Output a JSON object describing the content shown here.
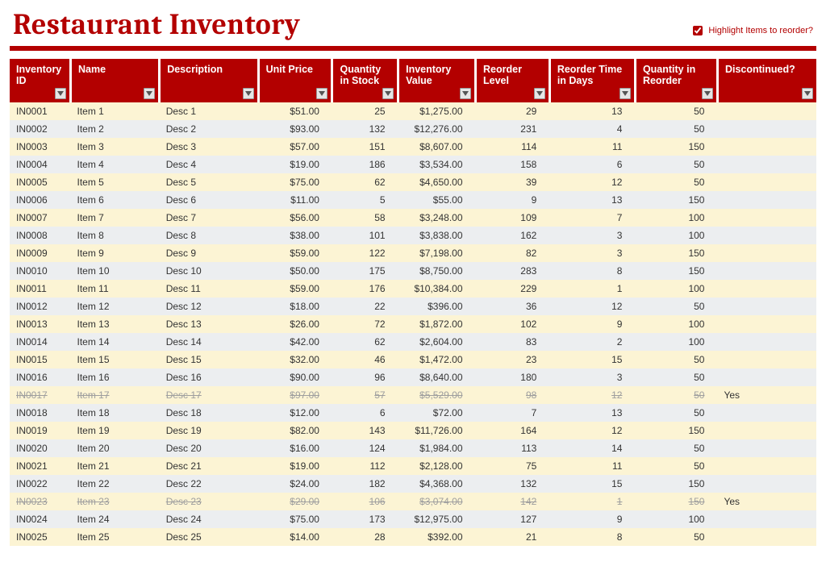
{
  "title": "Restaurant Inventory",
  "highlight": {
    "label": "Highlight Items to reorder?",
    "checked": true
  },
  "columns": [
    {
      "key": "id",
      "label": "Inventory ID",
      "class": "col-id",
      "align": "left"
    },
    {
      "key": "name",
      "label": "Name",
      "class": "col-name",
      "align": "left"
    },
    {
      "key": "description",
      "label": "Description",
      "class": "col-desc",
      "align": "left"
    },
    {
      "key": "unit_price",
      "label": "Unit Price",
      "class": "col-price",
      "align": "right"
    },
    {
      "key": "qty_in_stock",
      "label": "Quantity in Stock",
      "class": "col-stock",
      "align": "right"
    },
    {
      "key": "inv_value",
      "label": "Inventory Value",
      "class": "col-value",
      "align": "right"
    },
    {
      "key": "reorder_level",
      "label": "Reorder Level",
      "class": "col-reorder-level",
      "align": "right"
    },
    {
      "key": "reorder_time",
      "label": "Reorder Time in Days",
      "class": "col-reorder-time",
      "align": "right"
    },
    {
      "key": "reorder_qty",
      "label": "Quantity in Reorder",
      "class": "col-reorder-qty",
      "align": "right"
    },
    {
      "key": "discontinued",
      "label": "Discontinued?",
      "class": "col-disc",
      "align": "left"
    }
  ],
  "rows": [
    {
      "id": "IN0001",
      "name": "Item 1",
      "description": "Desc 1",
      "unit_price": "$51.00",
      "qty_in_stock": "25",
      "inv_value": "$1,275.00",
      "reorder_level": "29",
      "reorder_time": "13",
      "reorder_qty": "50",
      "discontinued": ""
    },
    {
      "id": "IN0002",
      "name": "Item 2",
      "description": "Desc 2",
      "unit_price": "$93.00",
      "qty_in_stock": "132",
      "inv_value": "$12,276.00",
      "reorder_level": "231",
      "reorder_time": "4",
      "reorder_qty": "50",
      "discontinued": ""
    },
    {
      "id": "IN0003",
      "name": "Item 3",
      "description": "Desc 3",
      "unit_price": "$57.00",
      "qty_in_stock": "151",
      "inv_value": "$8,607.00",
      "reorder_level": "114",
      "reorder_time": "11",
      "reorder_qty": "150",
      "discontinued": ""
    },
    {
      "id": "IN0004",
      "name": "Item 4",
      "description": "Desc 4",
      "unit_price": "$19.00",
      "qty_in_stock": "186",
      "inv_value": "$3,534.00",
      "reorder_level": "158",
      "reorder_time": "6",
      "reorder_qty": "50",
      "discontinued": ""
    },
    {
      "id": "IN0005",
      "name": "Item 5",
      "description": "Desc 5",
      "unit_price": "$75.00",
      "qty_in_stock": "62",
      "inv_value": "$4,650.00",
      "reorder_level": "39",
      "reorder_time": "12",
      "reorder_qty": "50",
      "discontinued": ""
    },
    {
      "id": "IN0006",
      "name": "Item 6",
      "description": "Desc 6",
      "unit_price": "$11.00",
      "qty_in_stock": "5",
      "inv_value": "$55.00",
      "reorder_level": "9",
      "reorder_time": "13",
      "reorder_qty": "150",
      "discontinued": ""
    },
    {
      "id": "IN0007",
      "name": "Item 7",
      "description": "Desc 7",
      "unit_price": "$56.00",
      "qty_in_stock": "58",
      "inv_value": "$3,248.00",
      "reorder_level": "109",
      "reorder_time": "7",
      "reorder_qty": "100",
      "discontinued": ""
    },
    {
      "id": "IN0008",
      "name": "Item 8",
      "description": "Desc 8",
      "unit_price": "$38.00",
      "qty_in_stock": "101",
      "inv_value": "$3,838.00",
      "reorder_level": "162",
      "reorder_time": "3",
      "reorder_qty": "100",
      "discontinued": ""
    },
    {
      "id": "IN0009",
      "name": "Item 9",
      "description": "Desc 9",
      "unit_price": "$59.00",
      "qty_in_stock": "122",
      "inv_value": "$7,198.00",
      "reorder_level": "82",
      "reorder_time": "3",
      "reorder_qty": "150",
      "discontinued": ""
    },
    {
      "id": "IN0010",
      "name": "Item 10",
      "description": "Desc 10",
      "unit_price": "$50.00",
      "qty_in_stock": "175",
      "inv_value": "$8,750.00",
      "reorder_level": "283",
      "reorder_time": "8",
      "reorder_qty": "150",
      "discontinued": ""
    },
    {
      "id": "IN0011",
      "name": "Item 11",
      "description": "Desc 11",
      "unit_price": "$59.00",
      "qty_in_stock": "176",
      "inv_value": "$10,384.00",
      "reorder_level": "229",
      "reorder_time": "1",
      "reorder_qty": "100",
      "discontinued": ""
    },
    {
      "id": "IN0012",
      "name": "Item 12",
      "description": "Desc 12",
      "unit_price": "$18.00",
      "qty_in_stock": "22",
      "inv_value": "$396.00",
      "reorder_level": "36",
      "reorder_time": "12",
      "reorder_qty": "50",
      "discontinued": ""
    },
    {
      "id": "IN0013",
      "name": "Item 13",
      "description": "Desc 13",
      "unit_price": "$26.00",
      "qty_in_stock": "72",
      "inv_value": "$1,872.00",
      "reorder_level": "102",
      "reorder_time": "9",
      "reorder_qty": "100",
      "discontinued": ""
    },
    {
      "id": "IN0014",
      "name": "Item 14",
      "description": "Desc 14",
      "unit_price": "$42.00",
      "qty_in_stock": "62",
      "inv_value": "$2,604.00",
      "reorder_level": "83",
      "reorder_time": "2",
      "reorder_qty": "100",
      "discontinued": ""
    },
    {
      "id": "IN0015",
      "name": "Item 15",
      "description": "Desc 15",
      "unit_price": "$32.00",
      "qty_in_stock": "46",
      "inv_value": "$1,472.00",
      "reorder_level": "23",
      "reorder_time": "15",
      "reorder_qty": "50",
      "discontinued": ""
    },
    {
      "id": "IN0016",
      "name": "Item 16",
      "description": "Desc 16",
      "unit_price": "$90.00",
      "qty_in_stock": "96",
      "inv_value": "$8,640.00",
      "reorder_level": "180",
      "reorder_time": "3",
      "reorder_qty": "50",
      "discontinued": ""
    },
    {
      "id": "IN0017",
      "name": "Item 17",
      "description": "Desc 17",
      "unit_price": "$97.00",
      "qty_in_stock": "57",
      "inv_value": "$5,529.00",
      "reorder_level": "98",
      "reorder_time": "12",
      "reorder_qty": "50",
      "discontinued": "Yes"
    },
    {
      "id": "IN0018",
      "name": "Item 18",
      "description": "Desc 18",
      "unit_price": "$12.00",
      "qty_in_stock": "6",
      "inv_value": "$72.00",
      "reorder_level": "7",
      "reorder_time": "13",
      "reorder_qty": "50",
      "discontinued": ""
    },
    {
      "id": "IN0019",
      "name": "Item 19",
      "description": "Desc 19",
      "unit_price": "$82.00",
      "qty_in_stock": "143",
      "inv_value": "$11,726.00",
      "reorder_level": "164",
      "reorder_time": "12",
      "reorder_qty": "150",
      "discontinued": ""
    },
    {
      "id": "IN0020",
      "name": "Item 20",
      "description": "Desc 20",
      "unit_price": "$16.00",
      "qty_in_stock": "124",
      "inv_value": "$1,984.00",
      "reorder_level": "113",
      "reorder_time": "14",
      "reorder_qty": "50",
      "discontinued": ""
    },
    {
      "id": "IN0021",
      "name": "Item 21",
      "description": "Desc 21",
      "unit_price": "$19.00",
      "qty_in_stock": "112",
      "inv_value": "$2,128.00",
      "reorder_level": "75",
      "reorder_time": "11",
      "reorder_qty": "50",
      "discontinued": ""
    },
    {
      "id": "IN0022",
      "name": "Item 22",
      "description": "Desc 22",
      "unit_price": "$24.00",
      "qty_in_stock": "182",
      "inv_value": "$4,368.00",
      "reorder_level": "132",
      "reorder_time": "15",
      "reorder_qty": "150",
      "discontinued": ""
    },
    {
      "id": "IN0023",
      "name": "Item 23",
      "description": "Desc 23",
      "unit_price": "$29.00",
      "qty_in_stock": "106",
      "inv_value": "$3,074.00",
      "reorder_level": "142",
      "reorder_time": "1",
      "reorder_qty": "150",
      "discontinued": "Yes"
    },
    {
      "id": "IN0024",
      "name": "Item 24",
      "description": "Desc 24",
      "unit_price": "$75.00",
      "qty_in_stock": "173",
      "inv_value": "$12,975.00",
      "reorder_level": "127",
      "reorder_time": "9",
      "reorder_qty": "100",
      "discontinued": ""
    },
    {
      "id": "IN0025",
      "name": "Item 25",
      "description": "Desc 25",
      "unit_price": "$14.00",
      "qty_in_stock": "28",
      "inv_value": "$392.00",
      "reorder_level": "21",
      "reorder_time": "8",
      "reorder_qty": "50",
      "discontinued": ""
    }
  ]
}
